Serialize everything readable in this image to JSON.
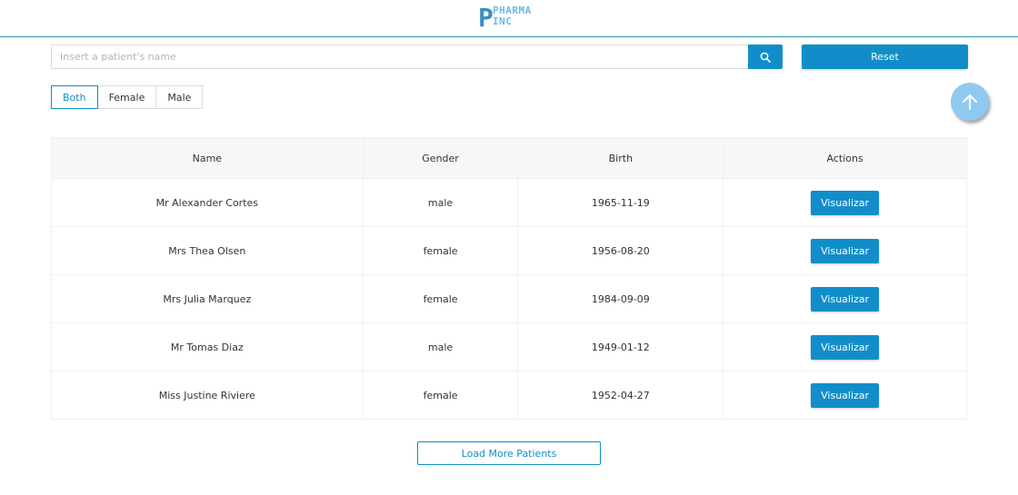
{
  "brand": {
    "logo_letter": "P",
    "logo_line1": "PHARMA",
    "logo_line2": "INC"
  },
  "search": {
    "placeholder": "Insert a patient's name",
    "value": "",
    "icon": "search-icon"
  },
  "reset_label": "Reset",
  "filters": [
    {
      "label": "Both",
      "active": true
    },
    {
      "label": "Female",
      "active": false
    },
    {
      "label": "Male",
      "active": false
    }
  ],
  "fab_icon": "arrow-up-icon",
  "table": {
    "headers": [
      "Name",
      "Gender",
      "Birth",
      "Actions"
    ],
    "rows": [
      {
        "name": "Mr Alexander Cortes",
        "gender": "male",
        "birth": "1965-11-19",
        "action": "Visualizar"
      },
      {
        "name": "Mrs Thea Olsen",
        "gender": "female",
        "birth": "1956-08-20",
        "action": "Visualizar"
      },
      {
        "name": "Mrs Julia Marquez",
        "gender": "female",
        "birth": "1984-09-09",
        "action": "Visualizar"
      },
      {
        "name": "Mr Tomas Diaz",
        "gender": "male",
        "birth": "1949-01-12",
        "action": "Visualizar"
      },
      {
        "name": "Miss Justine Riviere",
        "gender": "female",
        "birth": "1952-04-27",
        "action": "Visualizar"
      }
    ]
  },
  "load_more_label": "Load More Patients",
  "colors": {
    "accent": "#118ec9",
    "fab": "#8fc9f0",
    "header_line": "#2e9aa6"
  }
}
